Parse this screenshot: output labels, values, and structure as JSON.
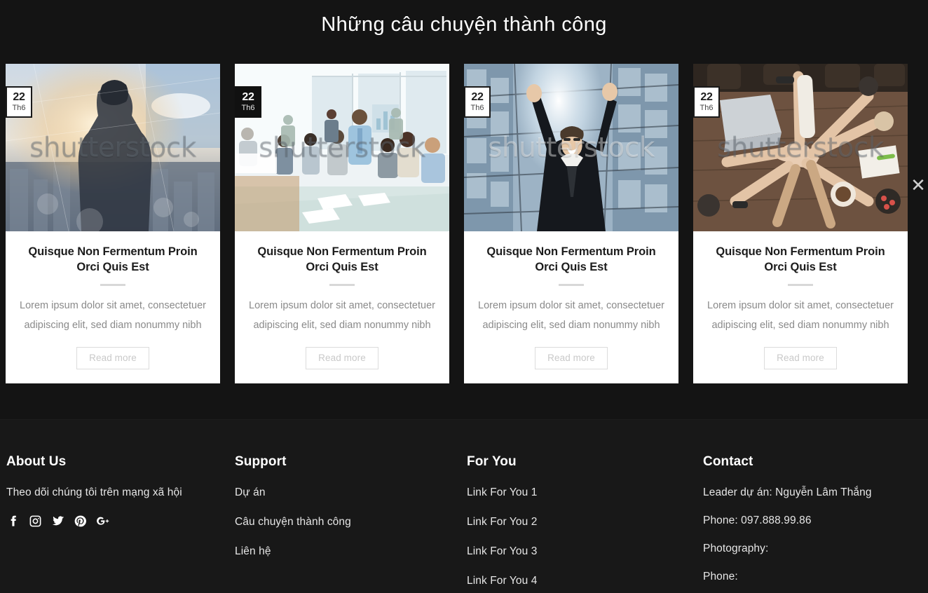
{
  "section": {
    "title": "Những câu chuyện thành công"
  },
  "slider": {
    "next_icon": "chevron-right-icon",
    "next_glyph": "✕"
  },
  "cards": [
    {
      "date_day": "22",
      "date_month": "Th6",
      "badge_style": "light",
      "image_alt": "businessman-looking-at-sunrise-city-double-exposure",
      "watermark": "shutterstock",
      "title": "Quisque Non Fermentum Proin Orci Quis Est",
      "text": "Lorem ipsum dolor sit amet, consectetuer adipiscing elit, sed diam nonummy nibh",
      "button": "Read more"
    },
    {
      "date_day": "22",
      "date_month": "Th6",
      "badge_style": "dark",
      "image_alt": "business-team-meeting-in-bright-office",
      "watermark": "shutterstock",
      "title": "Quisque Non Fermentum Proin Orci Quis Est",
      "text": "Lorem ipsum dolor sit amet, consectetuer adipiscing elit, sed diam nonummy nibh",
      "button": "Read more"
    },
    {
      "date_day": "22",
      "date_month": "Th6",
      "badge_style": "light",
      "image_alt": "celebrating-businessman-arms-raised-skyscraper",
      "watermark": "shutterstock",
      "title": "Quisque Non Fermentum Proin Orci Quis Est",
      "text": "Lorem ipsum dolor sit amet, consectetuer adipiscing elit, sed diam nonummy nibh",
      "button": "Read more"
    },
    {
      "date_day": "22",
      "date_month": "Th6",
      "badge_style": "light",
      "image_alt": "team-hands-together-over-wooden-desk-top-view",
      "watermark": "shutterstock",
      "title": "Quisque Non Fermentum Proin Orci Quis Est",
      "text": "Lorem ipsum dolor sit amet, consectetuer adipiscing elit, sed diam nonummy nibh",
      "button": "Read more"
    }
  ],
  "footer": {
    "about": {
      "heading": "About Us",
      "text": "Theo dõi chúng tôi trên mạng xã hội",
      "socials": [
        {
          "name": "facebook-icon",
          "label": "Facebook"
        },
        {
          "name": "instagram-icon",
          "label": "Instagram"
        },
        {
          "name": "twitter-icon",
          "label": "Twitter"
        },
        {
          "name": "pinterest-icon",
          "label": "Pinterest"
        },
        {
          "name": "google-plus-icon",
          "label": "Google Plus"
        }
      ]
    },
    "support": {
      "heading": "Support",
      "links": [
        "Dự án",
        "Câu chuyện thành công",
        "Liên hệ"
      ]
    },
    "for_you": {
      "heading": "For You",
      "links": [
        "Link For You 1",
        "Link For You 2",
        "Link For You 3",
        "Link For You 4"
      ]
    },
    "contact": {
      "heading": "Contact",
      "lines": [
        "Leader  dự án: Nguyễn Lâm Thắng",
        "Phone: 097.888.99.86",
        "Photography:",
        "Phone:"
      ]
    }
  },
  "colors": {
    "page_background": "#141414",
    "footer_background": "#181818",
    "card_background": "#ffffff",
    "title_text": "#ffffff",
    "card_title_text": "#1c1c1c",
    "card_body_text": "#8a8a8a",
    "button_border": "#dcdcdc",
    "button_text": "#c9c9c9"
  }
}
